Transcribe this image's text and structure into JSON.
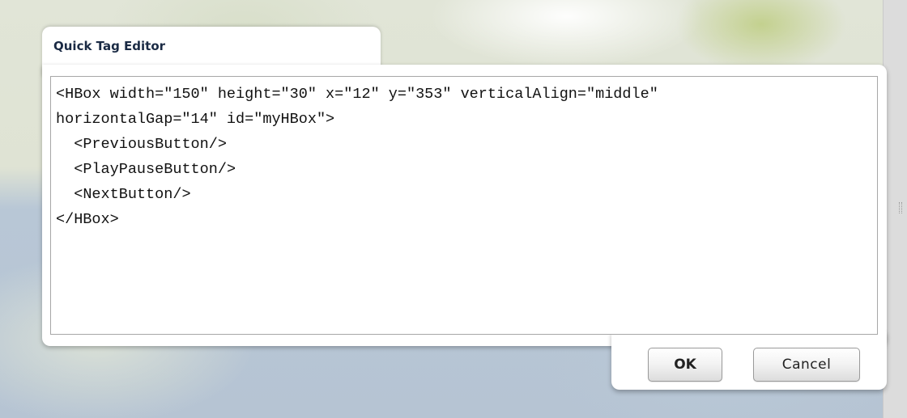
{
  "dialog": {
    "title": "Quick Tag Editor",
    "code": "<HBox width=\"150\" height=\"30\" x=\"12\" y=\"353\" verticalAlign=\"middle\"\nhorizontalGap=\"14\" id=\"myHBox\">\n  <PreviousButton/>\n  <PlayPauseButton/>\n  <NextButton/>\n</HBox>",
    "ok_label": "OK",
    "cancel_label": "Cancel"
  },
  "colors": {
    "title_text": "#1a2a44",
    "dialog_background": "#ffffff",
    "editor_border": "#a7a7a7"
  }
}
